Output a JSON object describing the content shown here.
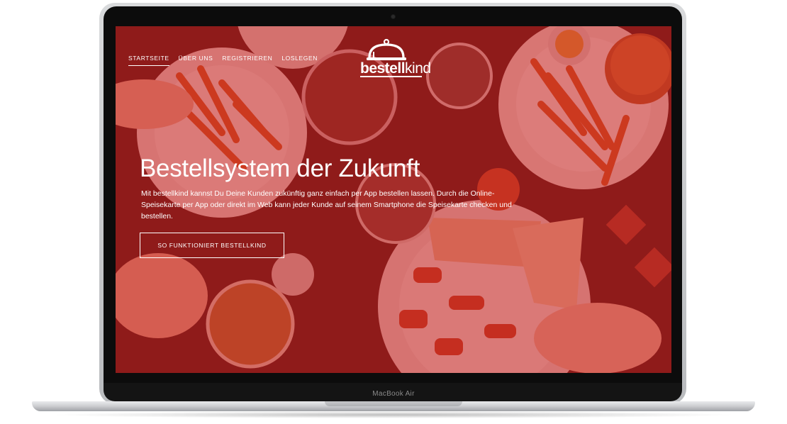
{
  "device": {
    "model_label": "MacBook Air"
  },
  "nav": {
    "items": [
      {
        "label": "STARTSEITE",
        "active": true
      },
      {
        "label": "ÜBER UNS",
        "active": false
      },
      {
        "label": "REGISTRIEREN",
        "active": false
      },
      {
        "label": "LOSLEGEN",
        "active": false
      }
    ]
  },
  "logo": {
    "bold": "bestell",
    "light": "kind"
  },
  "hero": {
    "title": "Bestellsystem der Zukunft",
    "description": "Mit bestellkind kannst Du Deine Kunden zukünftig ganz einfach per App bestellen lassen. Durch die Online-Speisekarte per App oder direkt im Web kann jeder Kunde auf seinem Smartphone die Speisekarte checken und bestellen.",
    "cta_label": "SO FUNKTIONIERT BESTELLKIND"
  },
  "colors": {
    "overlay": "#c82323",
    "text": "#ffffff"
  }
}
